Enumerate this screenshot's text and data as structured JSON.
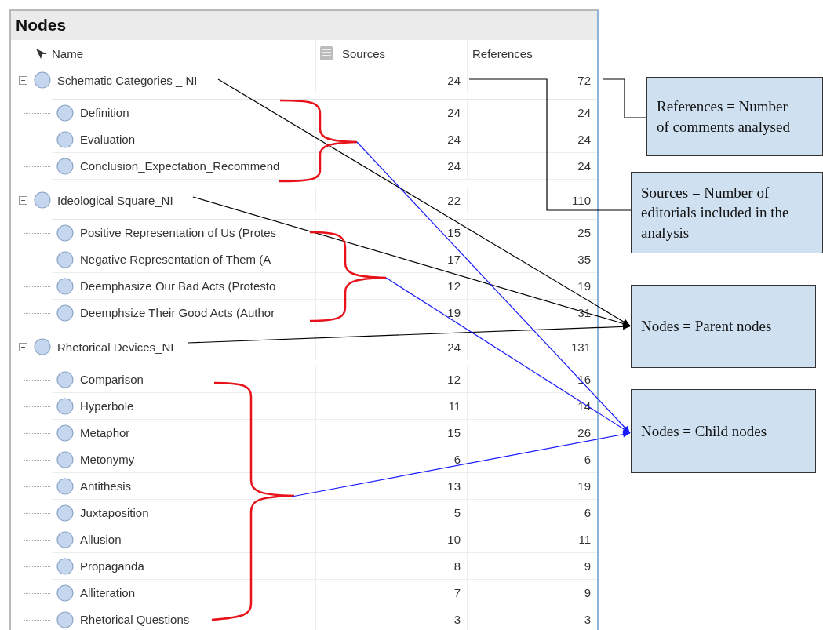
{
  "panel": {
    "title": "Nodes"
  },
  "columns": [
    "Name",
    "Sources",
    "References"
  ],
  "nodes": [
    {
      "name": "Schematic Categories _ NI",
      "sources": "24",
      "references": "72",
      "expanded": true,
      "children": [
        {
          "name": "Definition",
          "sources": "24",
          "references": "24"
        },
        {
          "name": "Evaluation",
          "sources": "24",
          "references": "24"
        },
        {
          "name": "Conclusion_Expectation_Recommend",
          "sources": "24",
          "references": "24"
        }
      ]
    },
    {
      "name": "Ideological Square_NI",
      "sources": "22",
      "references": "110",
      "expanded": true,
      "children": [
        {
          "name": "Positive Representation of Us (Protes",
          "sources": "15",
          "references": "25"
        },
        {
          "name": "Negative Representation of Them (A",
          "sources": "17",
          "references": "35"
        },
        {
          "name": "Deemphasize Our Bad Acts (Protesto",
          "sources": "12",
          "references": "19"
        },
        {
          "name": "Deemphsize Their Good Acts (Author",
          "sources": "19",
          "references": "31"
        }
      ]
    },
    {
      "name": "Rhetorical Devices_NI",
      "sources": "24",
      "references": "131",
      "expanded": true,
      "children": [
        {
          "name": "Comparison",
          "sources": "12",
          "references": "16"
        },
        {
          "name": "Hyperbole",
          "sources": "11",
          "references": "14"
        },
        {
          "name": "Metaphor",
          "sources": "15",
          "references": "26"
        },
        {
          "name": "Metonymy",
          "sources": "6",
          "references": "6"
        },
        {
          "name": "Antithesis",
          "sources": "13",
          "references": "19"
        },
        {
          "name": "Juxtaposition",
          "sources": "5",
          "references": "6"
        },
        {
          "name": "Allusion",
          "sources": "10",
          "references": "11"
        },
        {
          "name": "Propaganda",
          "sources": "8",
          "references": "9"
        },
        {
          "name": "Alliteration",
          "sources": "7",
          "references": "9"
        },
        {
          "name": "Rhetorical Questions",
          "sources": "3",
          "references": "3"
        }
      ]
    }
  ],
  "annotations": [
    {
      "text": "References = Number of comments analysed"
    },
    {
      "text": "Sources = Number of editorials included in the analysis"
    },
    {
      "text": "Nodes = Parent nodes"
    },
    {
      "text": "Nodes = Child nodes"
    }
  ]
}
